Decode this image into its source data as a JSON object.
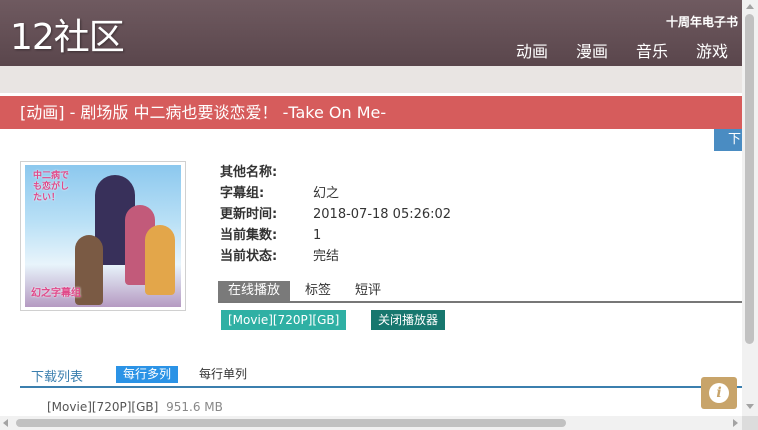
{
  "site": {
    "logo": "12社区",
    "tenth_anniversary_link": "十周年电子书",
    "nav": [
      "动画",
      "漫画",
      "音乐",
      "游戏"
    ]
  },
  "page": {
    "title": "[动画] - 剧场版 中二病也要谈恋爱！ -Take On Me-",
    "download_button": "下"
  },
  "cover": {
    "title_text": "中二病でも恋がしたい！",
    "group_text": "幻之字幕组"
  },
  "info": [
    {
      "label": "其他名称:",
      "value": ""
    },
    {
      "label": "字幕组:",
      "value": "幻之"
    },
    {
      "label": "更新时间:",
      "value": "2018-07-18 05:26:02"
    },
    {
      "label": "当前集数:",
      "value": "1"
    },
    {
      "label": "当前状态:",
      "value": "完结"
    }
  ],
  "tabs": [
    "在线播放",
    "标签",
    "短评"
  ],
  "player": {
    "episode_button": "[Movie][720P][GB]",
    "close_button": "关闭播放器"
  },
  "download_list": {
    "title": "下载列表",
    "option_multi": "每行多列",
    "option_single": "每行单列",
    "files": [
      {
        "name": "[Movie][720P][GB]",
        "size": "951.6 MB"
      }
    ]
  },
  "colors": {
    "header": "#6f5a60",
    "title_bar": "#d65c5c",
    "download_button": "#4a8cc2",
    "episode_button": "#2fb0a4",
    "close_button": "#17776e",
    "accent_blue": "#2b93e6",
    "info_float": "#c8a46a"
  },
  "icons": {
    "info_float": "info-icon"
  }
}
